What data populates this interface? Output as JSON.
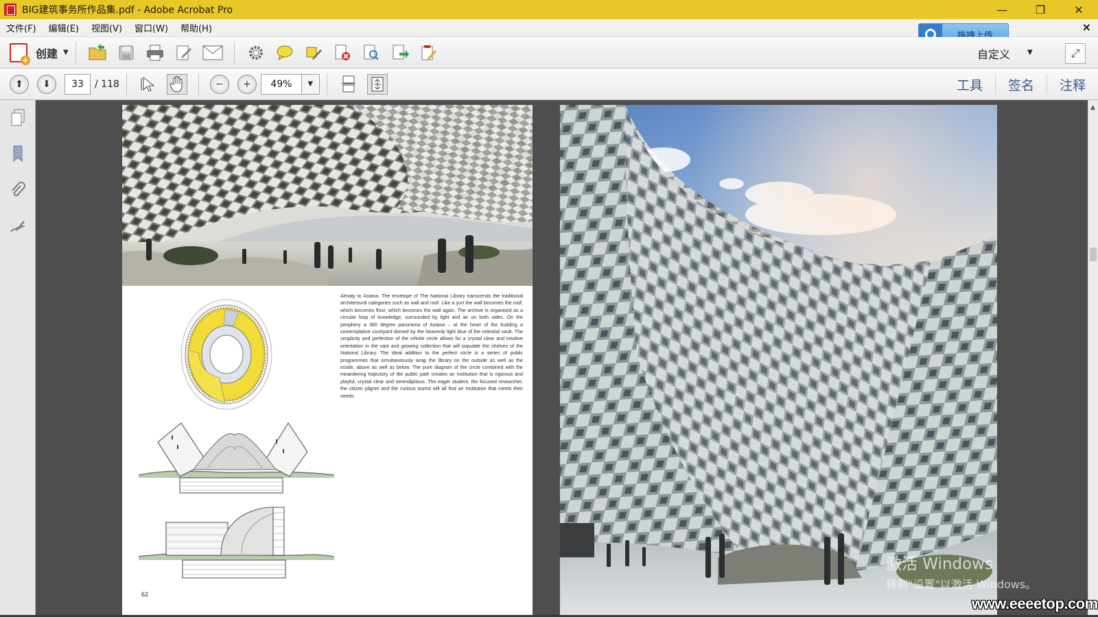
{
  "window": {
    "title": "BIG建筑事务所作品集.pdf - Adobe Acrobat Pro",
    "minimize": "—",
    "restore": "❐",
    "close": "✕"
  },
  "menu": {
    "items": [
      "文件(F)",
      "编辑(E)",
      "视图(V)",
      "窗口(W)",
      "帮助(H)"
    ],
    "close": "×"
  },
  "upload": {
    "label": "拖拽上传"
  },
  "toolbar": {
    "create_label": "创建",
    "custom_label": "自定义",
    "icons": [
      "open-folder-icon",
      "save-icon",
      "print-icon",
      "edit-icon",
      "email-icon",
      "settings-icon",
      "comment-icon",
      "highlight-icon",
      "delete-page-icon",
      "compare-icon",
      "export-icon",
      "form-icon"
    ]
  },
  "nav": {
    "current_page": "33",
    "total_pages": "/ 118",
    "zoom": "49%"
  },
  "right_tabs": [
    "工具",
    "签名",
    "注释"
  ],
  "document": {
    "body_text": "Almaty to Astana. The envelope of The National Library transcends the traditional architectural categories such as wall and roof. Like a yurt the wall becomes the roof, which becomes floor, which becomes the wall again. The archive is organised as a circular loop of knowledge, surrounded by light and air on both sides. On the periphery a 360 degree panorama of Astana – at the heart of the building a contemplative courtyard domed by the heavenly light blue of the celestial vault. The simplicity and perfection of the infinite circle allows for a crystal clear and intuitive orientation in the vast and growing collection that will populate the shelves of the National Library. The ideal addition to the perfect circle is a series of public programmes that simultaneously wrap the library on the outside as well as the inside, above as well as below. The pure diagram of the circle combined with the meandering trajectory of the public path creates an institution that is rigorous and playful, crystal clear and serendipitous. The eager student, the focused researcher, the citizen pilgrim and the curious tourist will all find an institution that meets their needs.",
    "page_number": "62"
  },
  "overlay": {
    "activate_title": "激活 Windows",
    "activate_sub": "转到\"设置\"以激活 Windows。",
    "watermark": "www.eeeetop.com"
  },
  "colors": {
    "titlebar": "#e8c826",
    "plan_yellow": "#f2dc3a",
    "tab_text": "#3b5a8c"
  }
}
